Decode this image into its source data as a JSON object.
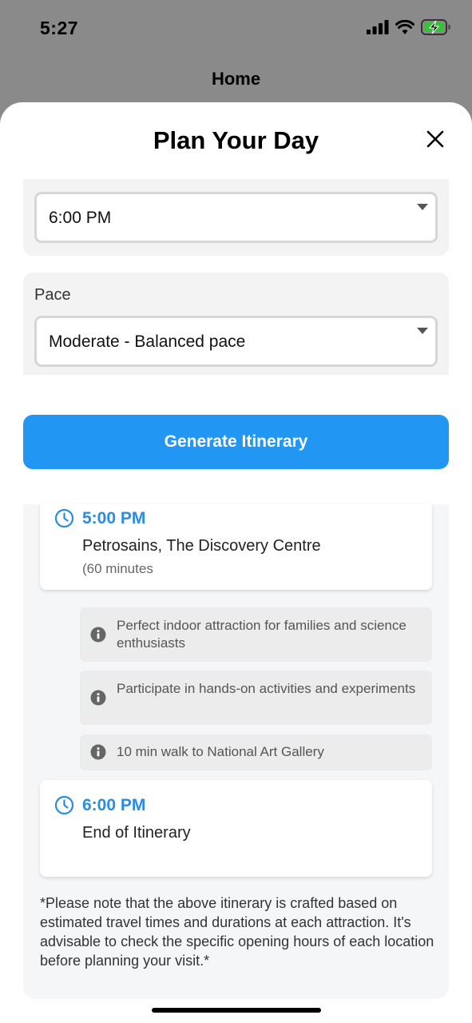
{
  "status_bar": {
    "time": "5:27",
    "icons": [
      "signal-icon",
      "wifi-icon",
      "battery-charging-icon"
    ]
  },
  "background_screen": {
    "title": "Home"
  },
  "sheet": {
    "title": "Plan Your Day",
    "close_icon": "close-icon"
  },
  "form": {
    "end_time": {
      "value": "6:00 PM"
    },
    "pace": {
      "label": "Pace",
      "value": "Moderate - Balanced pace"
    },
    "generate_label": "Generate Itinerary"
  },
  "itinerary": {
    "stops": [
      {
        "time": "5:00 PM",
        "place": "Petrosains, The Discovery Centre",
        "duration": "(60 minutes",
        "notes": [
          "Perfect indoor attraction for families and science enthusiasts",
          "Participate in hands-on activities and experiments",
          "10 min walk to National Art Gallery"
        ]
      },
      {
        "time": "6:00 PM",
        "place": "End of Itinerary"
      }
    ],
    "disclaimer": "*Please note that the above itinerary is crafted based on estimated travel times and durations at each attraction. It's advisable to check the specific opening hours of each location before planning your visit.*"
  },
  "colors": {
    "accent": "#2196f3",
    "time_text": "#2a8de0",
    "battery_charging": "#36c234"
  }
}
